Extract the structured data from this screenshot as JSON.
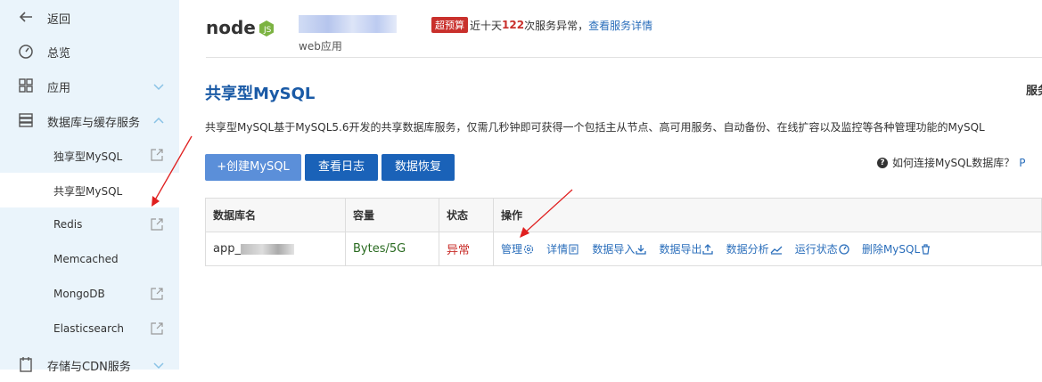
{
  "sidebar": {
    "back": "返回",
    "overview": "总览",
    "apps": "应用",
    "db_cache": "数据库与缓存服务",
    "sub_items": [
      "独享型MySQL",
      "共享型MySQL",
      "Redis",
      "Memcached",
      "MongoDB",
      "Elasticsearch"
    ],
    "storage": "存储与CDN服务"
  },
  "header": {
    "logo_text": "node",
    "app_type": "web应用",
    "badge": "超预算",
    "warn_prefix": "近十天",
    "warn_count": "122",
    "warn_suffix": "次服务异常，",
    "warn_link": "查看服务详情"
  },
  "main": {
    "title": "共享型MySQL",
    "title_right": "服务",
    "description": "共享型MySQL基于MySQL5.6开发的共享数据库服务，仅需几秒钟即可获得一个包括主从节点、高可用服务、自动备份、在线扩容以及监控等各种管理功能的MySQL",
    "buttons": {
      "create": "+创建MySQL",
      "logs": "查看日志",
      "restore": "数据恢复"
    },
    "help_text": "如何连接MySQL数据库？",
    "help_link": "P"
  },
  "table": {
    "headers": [
      "数据库名",
      "容量",
      "状态",
      "操作"
    ],
    "rows": [
      {
        "name": "app_",
        "capacity": "Bytes/5G",
        "status": "异常",
        "ops": [
          "管理",
          "详情",
          "数据导入",
          "数据导出",
          "数据分析",
          "运行状态",
          "删除MySQL"
        ]
      }
    ]
  },
  "colors": {
    "accent": "#1a62b8",
    "sidebar_bg": "#eaf4fb",
    "error": "#c9302c",
    "ok": "#2a6b21"
  }
}
